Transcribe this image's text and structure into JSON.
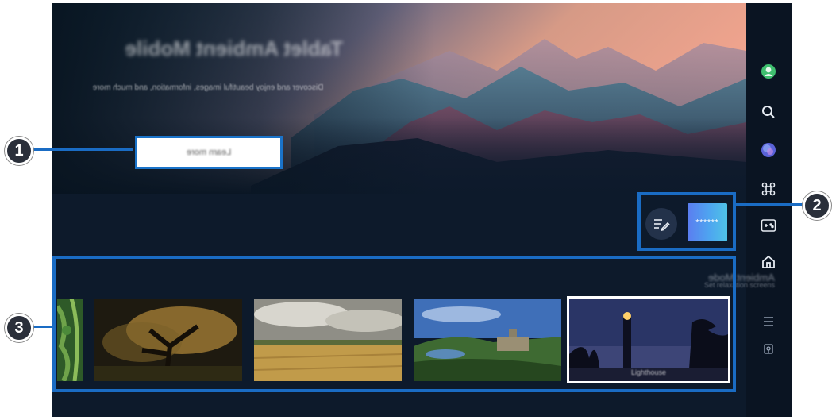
{
  "hero": {
    "title": "Tablet Ambient Mobile",
    "description": "Discover and enjoy beautiful images, information, and much more",
    "button_label": "Learn more"
  },
  "callouts": [
    "1",
    "2",
    "3"
  ],
  "featured": {
    "edit_icon": "edit-list-icon",
    "widget_label": "******"
  },
  "section": {
    "title": "Ambient Mode",
    "subtitle": "Set relaxation screens"
  },
  "tiles": [
    {
      "name": "jungle-leaves"
    },
    {
      "name": "tree-sunset"
    },
    {
      "name": "wheat-field"
    },
    {
      "name": "castle-hillside"
    },
    {
      "name": "lighthouse-night",
      "caption": "Lighthouse"
    }
  ],
  "sidebar": {
    "icons": [
      "profile-icon",
      "search-icon",
      "globe-icon",
      "command-icon",
      "game-controller-icon",
      "home-icon",
      "menu-icon",
      "privacy-icon"
    ]
  },
  "colors": {
    "accent_blue": "#1a6cc4",
    "background": "#0d1a2b",
    "profile_green": "#3fbf6f"
  }
}
